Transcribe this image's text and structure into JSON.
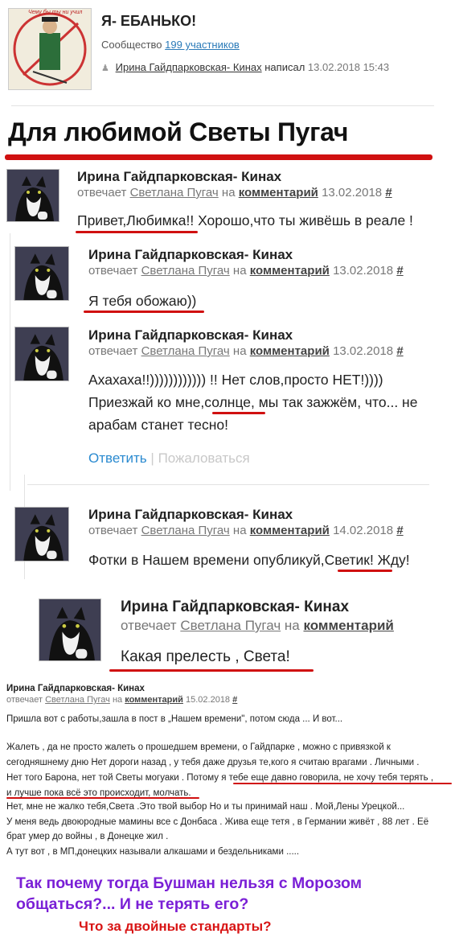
{
  "community": {
    "title": "Я- ЕБАНЬКО!",
    "members_prefix": "Сообщество",
    "members_link": "199 участников",
    "author": "Ирина Гайдпарковская- Кинах",
    "wrote": "написал",
    "date": "13.02.2018 15:43",
    "logo_text": "Чему бы ты ни учил"
  },
  "headline": "Для любимой Светы Пугач",
  "labels": {
    "replies": "отвечает",
    "on": "на",
    "comment": "комментарий",
    "hash": "#"
  },
  "comments": [
    {
      "author": "Ирина Гайдпарковская- Кинах",
      "to": "Светлана Пугач",
      "date": "13.02.2018",
      "text": "Привет,Любимка!! Хорошо,что ты живёшь в реале !"
    },
    {
      "author": "Ирина Гайдпарковская- Кинах",
      "to": "Светлана Пугач",
      "date": "13.02.2018",
      "text": "Я тебя обожаю))"
    },
    {
      "author": "Ирина Гайдпарковская- Кинах",
      "to": "Светлана Пугач",
      "date": "13.02.2018",
      "line1": "Ахахаха!!)))))))))))) !! Нет слов,просто НЕТ!))))",
      "line2": "Приезжай ко мне,солнце, мы так зажжём, что... не",
      "line3": "арабам станет тесно!",
      "reply": "Ответить",
      "sep": "|",
      "report": "Пожаловаться"
    },
    {
      "author": "Ирина Гайдпарковская- Кинах",
      "to": "Светлана Пугач",
      "date": "14.02.2018",
      "text": "Фотки в Нашем времени опубликуй,Светик! Жду!"
    },
    {
      "author": "Ирина Гайдпарковская- Кинах",
      "to": "Светлана Пугач",
      "text": "Какая прелесть , Света!"
    }
  ],
  "small_post": {
    "author": "Ирина Гайдпарковская- Кинах",
    "to": "Светлана Пугач",
    "date": "15.02.2018",
    "p1": "Пришла вот с работы,зашла в пост в „Нашем времени\", потом сюда ... И вот...",
    "p2": [
      "Жалеть , да не просто жалеть о прошедшем времени, о Гайдпарке , можно с привязкой к",
      "сегодняшнему дню Нет дороги назад , у тебя даже друзья те,кого я считаю врагами . Личными .",
      "Нет того Барона, нет той Светы могуаки . Потому я тебе еще давно говорила, не хочу тебя терять ,",
      " и лучше пока всё это происходит, молчать.",
      "Нет, мне не жалко тебя,Света .Это твой выбор Но и ты принимай наш . Мой,Лены Урецкой...",
      "У меня ведь двоюродные мамины все с Донбаса . Жива еще тетя , в Германии живёт , 88 лет . Её",
      "брат умер до войны , в Донецке жил .",
      "А тут вот , в МП,донецких называли алкашами и бездельниками ....."
    ]
  },
  "caption": {
    "line1": "Так почему тогда Бушман нельзя с Морозом",
    "line2": "общаться?... И не терять его?",
    "line3": "Что за двойные стандарты?"
  }
}
